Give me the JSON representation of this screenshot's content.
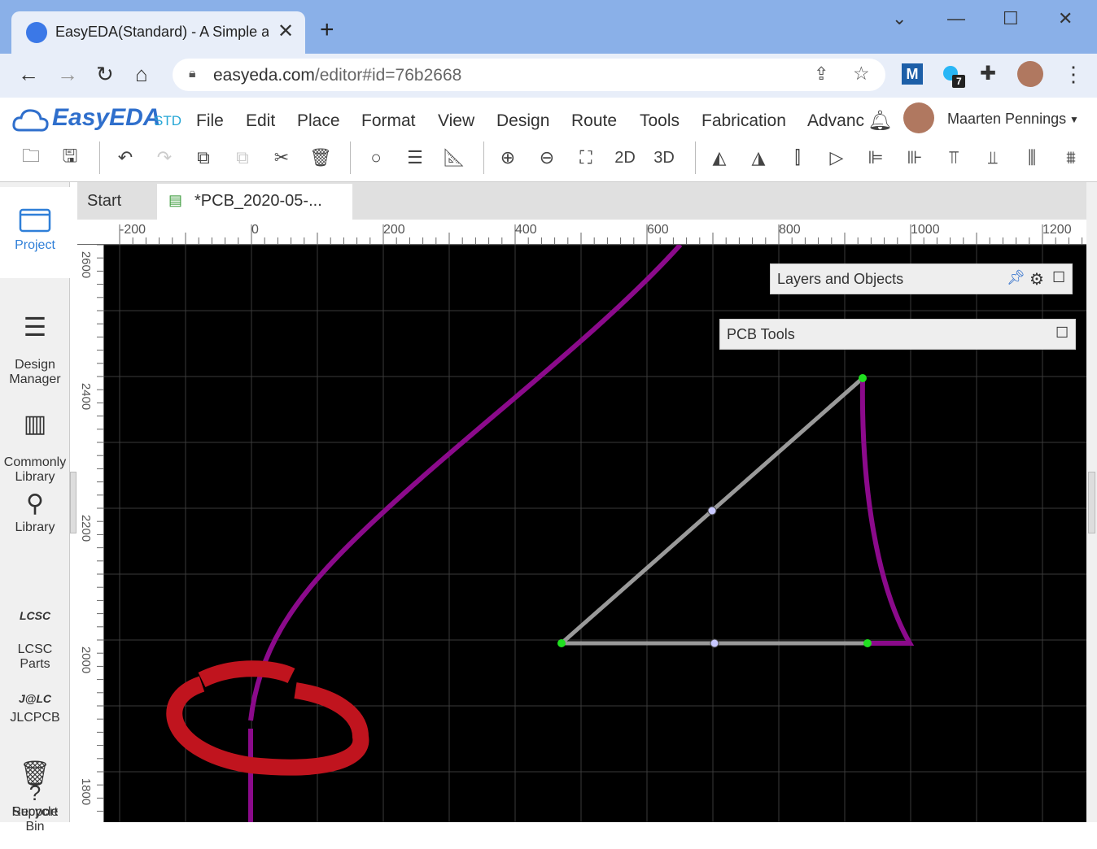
{
  "browser": {
    "tab_title": "EasyEDA(Standard) - A Simple an",
    "url_host": "easyeda.com",
    "url_path": "/editor#id=76b2668",
    "extension_badge": "7"
  },
  "app": {
    "logo_text": "EasyEDA",
    "logo_suffix": "STD",
    "menu": [
      "File",
      "Edit",
      "Place",
      "Format",
      "View",
      "Design",
      "Route",
      "Tools",
      "Fabrication",
      "Advanc"
    ],
    "user_name": "Maarten Pennings",
    "toolbar_text": {
      "two_d": "2D",
      "three_d": "3D"
    }
  },
  "sidebar": {
    "items": [
      {
        "label": "Project",
        "icon": "folder-icon"
      },
      {
        "label": "Design\nManager",
        "icon": "list-icon"
      },
      {
        "label": "Commonly\nLibrary",
        "icon": "chip-icon"
      },
      {
        "label": "Library",
        "icon": "library-search-icon"
      },
      {
        "label": "LCSC\nParts",
        "icon": "lcsc-icon"
      },
      {
        "label": "JLCPCB",
        "icon": "jlc-icon"
      },
      {
        "label": "Recycle\nBin",
        "icon": "trash-icon"
      },
      {
        "label": "Support",
        "icon": "help-icon"
      }
    ],
    "lcsc_logo": "LCSC",
    "jlc_logo": "J@LC"
  },
  "doc_tabs": [
    {
      "label": "Start"
    },
    {
      "label": "*PCB_2020-05-..."
    }
  ],
  "rulers": {
    "horizontal": [
      "-200",
      "0",
      "200",
      "400",
      "600",
      "800",
      "1000",
      "1200"
    ],
    "vertical": [
      "2600",
      "2400",
      "2200",
      "2000",
      "1800"
    ]
  },
  "panels": {
    "layers_title": "Layers and Objects",
    "pcb_tools_title": "PCB Tools"
  },
  "colors": {
    "titlebar": "#8ab0e8",
    "track_purple": "#8b0a8b",
    "track_gray": "#9a9a9a",
    "annotation_red": "#c0141e",
    "canvas_bg": "#000000",
    "grid": "#3a3a3a"
  }
}
